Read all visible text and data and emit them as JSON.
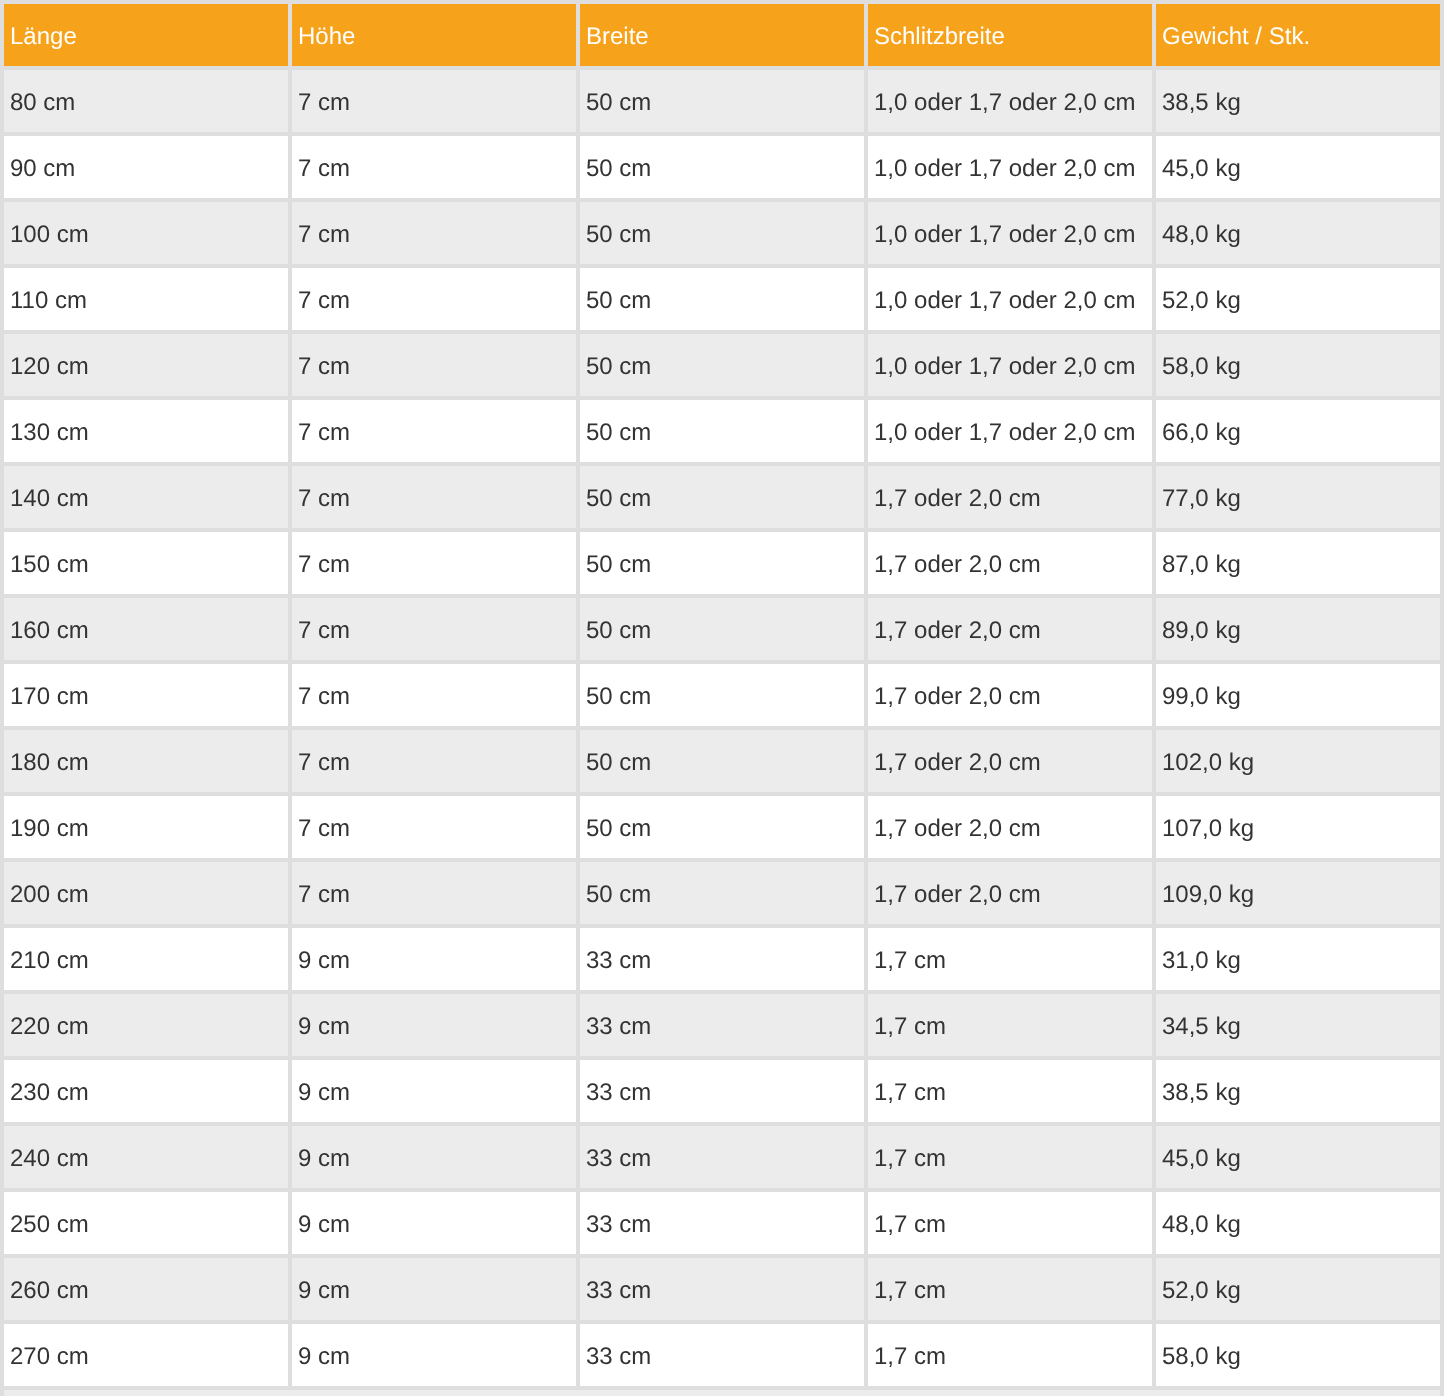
{
  "table": {
    "columns": [
      "Länge",
      "Höhe",
      "Breite",
      "Schlitzbreite",
      "Gewicht / Stk."
    ],
    "rows": [
      [
        "80 cm",
        "7 cm",
        "50 cm",
        "1,0 oder 1,7 oder 2,0 cm",
        "38,5 kg"
      ],
      [
        "90 cm",
        "7 cm",
        "50 cm",
        "1,0 oder 1,7 oder 2,0 cm",
        "45,0 kg"
      ],
      [
        "100 cm",
        "7 cm",
        "50 cm",
        "1,0 oder 1,7 oder 2,0 cm",
        "48,0 kg"
      ],
      [
        "110 cm",
        "7 cm",
        "50 cm",
        "1,0 oder 1,7 oder 2,0 cm",
        "52,0 kg"
      ],
      [
        "120 cm",
        "7 cm",
        "50 cm",
        "1,0 oder 1,7 oder 2,0 cm",
        "58,0 kg"
      ],
      [
        "130 cm",
        "7 cm",
        "50 cm",
        "1,0 oder 1,7 oder 2,0 cm",
        "66,0 kg"
      ],
      [
        "140 cm",
        "7 cm",
        "50 cm",
        "1,7 oder 2,0 cm",
        "77,0 kg"
      ],
      [
        "150 cm",
        "7 cm",
        "50 cm",
        "1,7 oder 2,0 cm",
        "87,0 kg"
      ],
      [
        "160 cm",
        "7 cm",
        "50 cm",
        "1,7 oder 2,0 cm",
        "89,0 kg"
      ],
      [
        "170 cm",
        "7 cm",
        "50 cm",
        "1,7 oder 2,0 cm",
        "99,0 kg"
      ],
      [
        "180 cm",
        "7 cm",
        "50 cm",
        "1,7 oder 2,0 cm",
        "102,0 kg"
      ],
      [
        "190 cm",
        "7 cm",
        "50 cm",
        "1,7 oder 2,0 cm",
        "107,0 kg"
      ],
      [
        "200 cm",
        "7 cm",
        "50 cm",
        "1,7 oder 2,0 cm",
        "109,0 kg"
      ],
      [
        "210 cm",
        "9 cm",
        "33 cm",
        "1,7 cm",
        "31,0 kg"
      ],
      [
        "220 cm",
        "9 cm",
        "33 cm",
        "1,7 cm",
        "34,5 kg"
      ],
      [
        "230 cm",
        "9 cm",
        "33 cm",
        "1,7 cm",
        "38,5 kg"
      ],
      [
        "240 cm",
        "9 cm",
        "33 cm",
        "1,7 cm",
        "45,0 kg"
      ],
      [
        "250 cm",
        "9 cm",
        "33 cm",
        "1,7 cm",
        "48,0 kg"
      ],
      [
        "260 cm",
        "9 cm",
        "33 cm",
        "1,7 cm",
        "52,0 kg"
      ],
      [
        "270 cm",
        "9 cm",
        "33 cm",
        "1,7 cm",
        "58,0 kg"
      ]
    ]
  }
}
